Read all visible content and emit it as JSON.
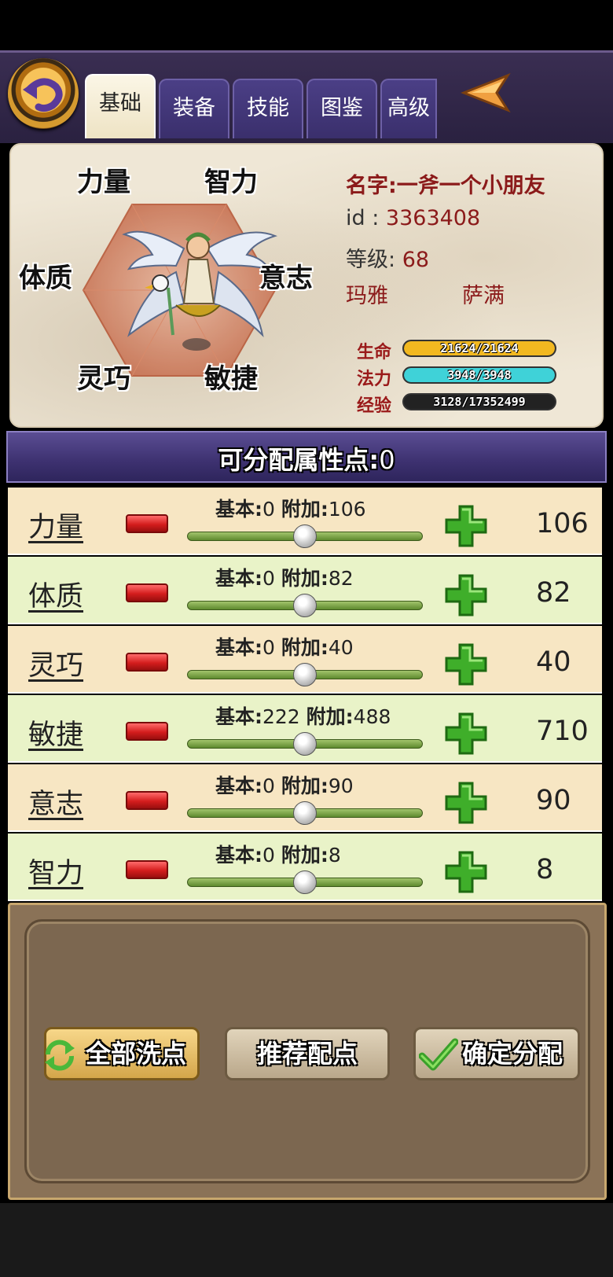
{
  "tabs": [
    {
      "label": "基础",
      "active": true
    },
    {
      "label": "装备",
      "active": false
    },
    {
      "label": "技能",
      "active": false
    },
    {
      "label": "图鉴",
      "active": false
    },
    {
      "label": "高级",
      "active": false
    }
  ],
  "hexagon_labels": {
    "strength": "力量",
    "intellect": "智力",
    "constitution": "体质",
    "will": "意志",
    "dexterity": "灵巧",
    "agility": "敏捷"
  },
  "character": {
    "name": "名字:一斧一个小朋友",
    "id_label": "id : ",
    "id_value": "3363408",
    "level_label": "等级: ",
    "level_value": "68",
    "race": "玛雅",
    "class": "萨满"
  },
  "bars": {
    "hp": {
      "label": "生命",
      "text": "21624/21624",
      "fraction": 1.0,
      "color": "#f2b820"
    },
    "mp": {
      "label": "法力",
      "text": "3948/3948",
      "fraction": 1.0,
      "color": "#3fd2d8"
    },
    "exp": {
      "label": "经验",
      "text": "3128/17352499",
      "fraction": 0.0002,
      "color": "#3a9aa0"
    }
  },
  "points": {
    "text": "可分配属性点:",
    "value": "0"
  },
  "attributes": [
    {
      "name": "力量",
      "base_label": "基本:",
      "base": "0",
      "bonus_label": "附加:",
      "bonus": "106",
      "total": "106",
      "slider": 0.5
    },
    {
      "name": "体质",
      "base_label": "基本:",
      "base": "0",
      "bonus_label": "附加:",
      "bonus": "82",
      "total": "82",
      "slider": 0.5
    },
    {
      "name": "灵巧",
      "base_label": "基本:",
      "base": "0",
      "bonus_label": "附加:",
      "bonus": "40",
      "total": "40",
      "slider": 0.5
    },
    {
      "name": "敏捷",
      "base_label": "基本:",
      "base": "222",
      "bonus_label": "附加:",
      "bonus": "488",
      "total": "710",
      "slider": 0.5
    },
    {
      "name": "意志",
      "base_label": "基本:",
      "base": "0",
      "bonus_label": "附加:",
      "bonus": "90",
      "total": "90",
      "slider": 0.5
    },
    {
      "name": "智力",
      "base_label": "基本:",
      "base": "0",
      "bonus_label": "附加:",
      "bonus": "8",
      "total": "8",
      "slider": 0.5
    }
  ],
  "actions": {
    "reset": "全部洗点",
    "recommend": "推荐配点",
    "confirm": "确定分配"
  },
  "icons": {
    "back": "back-arrow-icon",
    "collapse": "left-triangle-icon",
    "minus": "minus-icon",
    "plus": "plus-icon",
    "refresh": "refresh-icon",
    "check": "check-icon"
  }
}
